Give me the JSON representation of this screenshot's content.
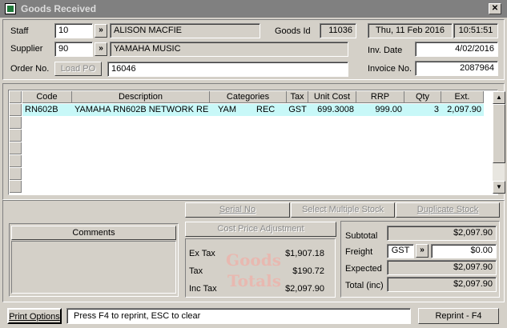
{
  "window": {
    "title": "Goods Received",
    "close_glyph": "✕"
  },
  "header": {
    "staff_label": "Staff",
    "staff_code": "10",
    "staff_name": "ALISON  MACFIE",
    "goods_id_label": "Goods Id",
    "goods_id": "11036",
    "date": "Thu, 11 Feb 2016",
    "time": "10:51:51",
    "supplier_label": "Supplier",
    "supplier_code": "90",
    "supplier_name": "YAMAHA MUSIC",
    "inv_date_label": "Inv. Date",
    "inv_date": "4/02/2016",
    "order_label": "Order No.",
    "load_po_label": "Load PO",
    "order_no": "16046",
    "invoice_label": "Invoice No.",
    "invoice_no": "2087964",
    "chevron": "»"
  },
  "table": {
    "columns": [
      "Code",
      "Description",
      "Categories",
      "Tax",
      "Unit Cost",
      "RRP",
      "Qty",
      "Ext."
    ],
    "rows": [
      {
        "code": "RN602B",
        "description": "YAMAHA RN602B NETWORK RE",
        "cat1": "YAM",
        "cat2": "REC",
        "tax": "GST",
        "unit_cost": "699.3008",
        "rrp": "999.00",
        "qty": "3",
        "ext": "2,097.90"
      }
    ]
  },
  "actions": {
    "serial_no": "Serial No",
    "select_multiple": "Select Multiple Stock",
    "duplicate": "Duplicate Stock",
    "cost_price_adj": "Cost Price Adjustment"
  },
  "comments": {
    "label": "Comments"
  },
  "goods_totals": {
    "title_line1": "Goods",
    "title_line2": "Totals",
    "ex_tax_label": "Ex Tax",
    "ex_tax": "$1,907.18",
    "tax_label": "Tax",
    "tax": "$190.72",
    "inc_tax_label": "Inc Tax",
    "inc_tax": "$2,097.90"
  },
  "summary": {
    "subtotal_label": "Subtotal",
    "subtotal": "$2,097.90",
    "freight_label": "Freight",
    "freight_tax": "GST",
    "freight": "$0.00",
    "expected_label": "Expected",
    "expected": "$2,097.90",
    "total_label": "Total (inc)",
    "total": "$2,097.90"
  },
  "footer": {
    "print_options": "Print Options",
    "hint": "Press F4 to reprint, ESC to clear",
    "reprint": "Reprint - F4"
  }
}
